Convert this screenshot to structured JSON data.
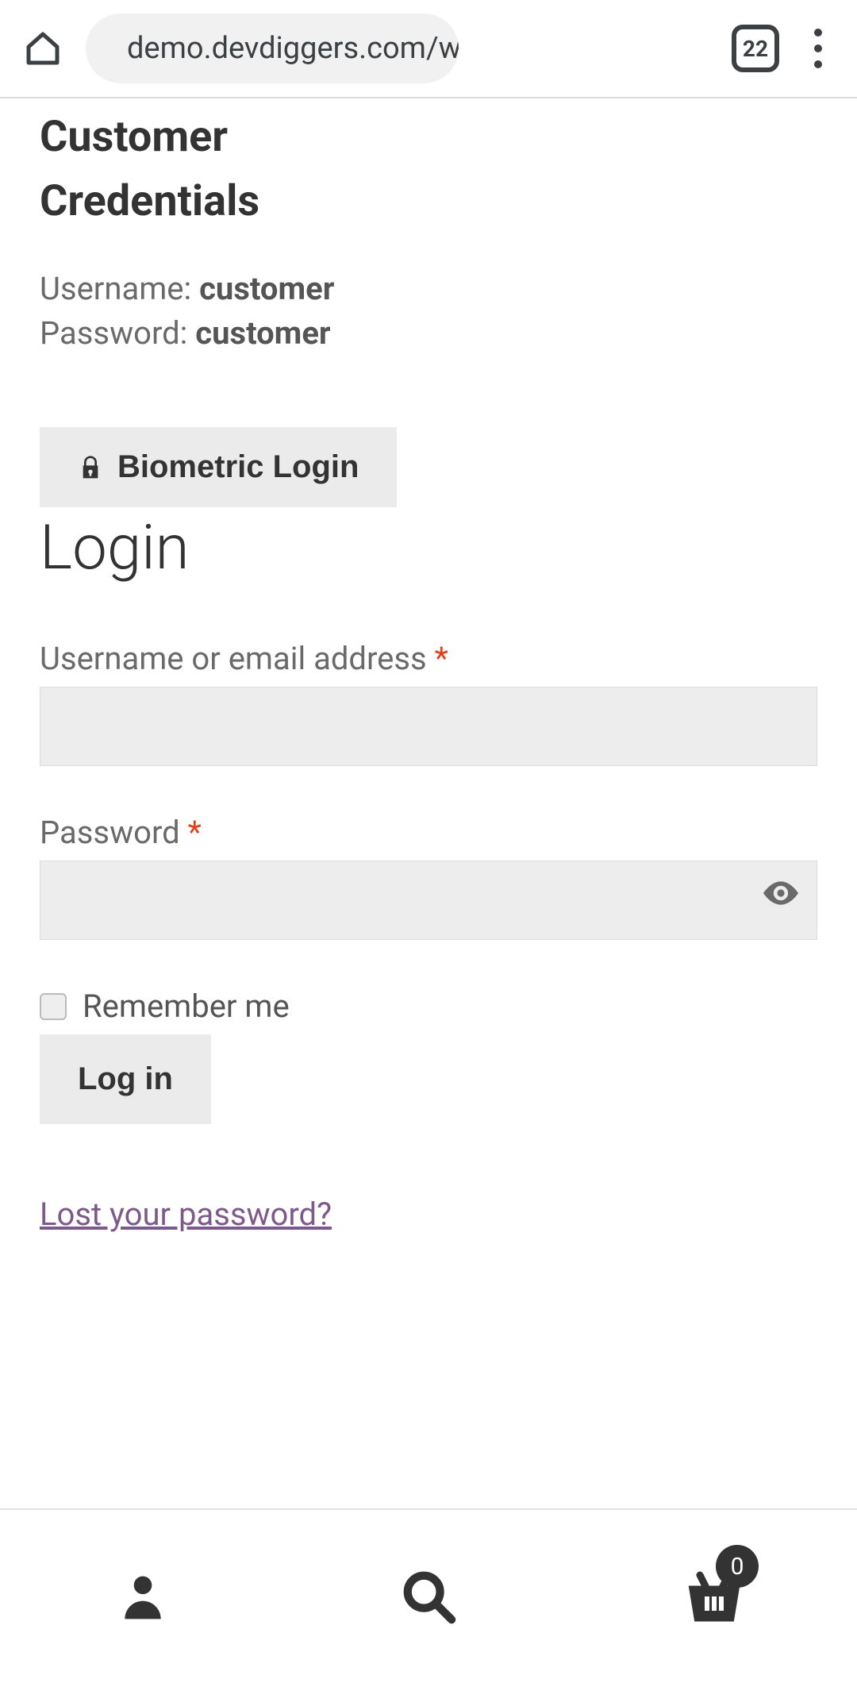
{
  "browser": {
    "url": "demo.devdiggers.com/woc",
    "tab_count": "22"
  },
  "credentials": {
    "heading_line1": "Customer",
    "heading_line2": "Credentials",
    "username_label": "Username: ",
    "username_value": "customer",
    "password_label": "Password: ",
    "password_value": "customer"
  },
  "biometric": {
    "label": "Biometric Login"
  },
  "login": {
    "heading": "Login",
    "username_label": "Username or email address ",
    "username_value": "",
    "password_label": "Password ",
    "password_value": "",
    "required_mark": "*",
    "remember_label": "Remember me",
    "submit_label": "Log in",
    "lost_password": "Lost your password?"
  },
  "bottom_nav": {
    "cart_count": "0"
  }
}
